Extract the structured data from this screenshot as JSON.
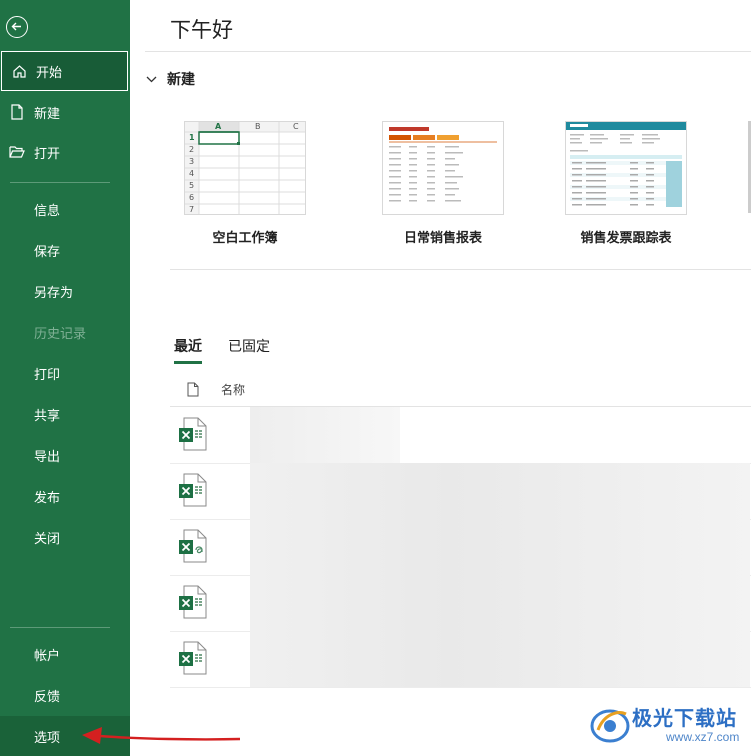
{
  "sidebar": {
    "items": [
      {
        "label": "开始"
      },
      {
        "label": "新建"
      },
      {
        "label": "打开"
      },
      {
        "label": "信息"
      },
      {
        "label": "保存"
      },
      {
        "label": "另存为"
      },
      {
        "label": "历史记录"
      },
      {
        "label": "打印"
      },
      {
        "label": "共享"
      },
      {
        "label": "导出"
      },
      {
        "label": "发布"
      },
      {
        "label": "关闭"
      },
      {
        "label": "帐户"
      },
      {
        "label": "反馈"
      },
      {
        "label": "选项"
      }
    ],
    "colors": {
      "background": "#207245",
      "active": "#185c37"
    }
  },
  "main": {
    "greeting": "下午好",
    "new_section": "新建",
    "templates": [
      {
        "label": "空白工作簿"
      },
      {
        "label": "日常销售报表"
      },
      {
        "label": "销售发票跟踪表"
      }
    ],
    "blank_thumb": {
      "col_headers": [
        "A",
        "B",
        "C"
      ],
      "row_headers": [
        "1",
        "2",
        "3",
        "4",
        "5",
        "6",
        "7"
      ]
    },
    "tabs": [
      {
        "label": "最近"
      },
      {
        "label": "已固定"
      }
    ],
    "recent_header": "名称"
  },
  "watermark": {
    "brand": "极光下载站",
    "url": "www.xz7.com"
  },
  "accent_color": "#207245"
}
